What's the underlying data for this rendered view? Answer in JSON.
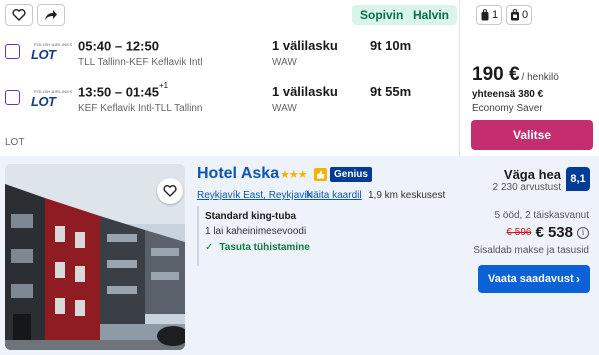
{
  "flight": {
    "badges": [
      "Sopivin",
      "Halvin"
    ],
    "bags": {
      "personal_count": "1",
      "carry_on_count": "0"
    },
    "legs": [
      {
        "airline_logo": {
          "text": "LOT",
          "tagline": "POLISH AIRLINES"
        },
        "times": "05:40 – 12:50",
        "day_offset": "",
        "route": "TLL Tallinn-KEF Keflavik Intl",
        "stops": "1 välilasku",
        "stop_airport": "WAW",
        "duration": "9t 10m"
      },
      {
        "airline_logo": {
          "text": "LOT",
          "tagline": "POLISH AIRLINES"
        },
        "times": "13:50 – 01:45",
        "day_offset": "+1",
        "route": "KEF Keflavik Intl-TLL Tallinn",
        "stops": "1 välilasku",
        "stop_airport": "WAW",
        "duration": "9t 55m"
      }
    ],
    "carrier": "LOT",
    "price": "190 €",
    "price_unit": "/ henkilö",
    "total": "yhteensä 380 €",
    "fare_class": "Economy Saver",
    "select_label": "Valitse"
  },
  "hotel": {
    "name": "Hotel Aska",
    "stars": "★★★",
    "genius_label": "Genius",
    "location_link": "Reykjavík East, Reykjavík",
    "map_link": "Näita kaardil",
    "distance": "1,9 km keskusest",
    "room_type": "Standard king-tuba",
    "bed_info": "1 lai kaheinimesevoodi",
    "cancel_info": "Tasuta tühistamine",
    "rating_word": "Väga hea",
    "review_count": "2 230 arvustust",
    "score": "8,1",
    "nights_info": "5 ööd, 2 täiskasvanut",
    "old_price": "€ 596",
    "new_price": "€ 538",
    "tax_info": "Sisaldab makse ja tasusid",
    "availability_label": "Vaata saadavust"
  },
  "colors": {
    "accent_pink": "#c42e6f",
    "link_blue": "#0b56b3",
    "button_blue": "#0b62d6",
    "score_navy": "#003b95",
    "badge_green_bg": "#d9f5ea",
    "cancel_green": "#107c3b"
  },
  "icons": {
    "favorite": "heart-outline-icon",
    "share": "share-arrow-icon",
    "personal_item": "backpack-icon",
    "carry_on": "suitcase-icon",
    "info": "info-icon",
    "chevron": "chevron-right-icon",
    "genius_thumb": "thumbs-up-icon"
  }
}
